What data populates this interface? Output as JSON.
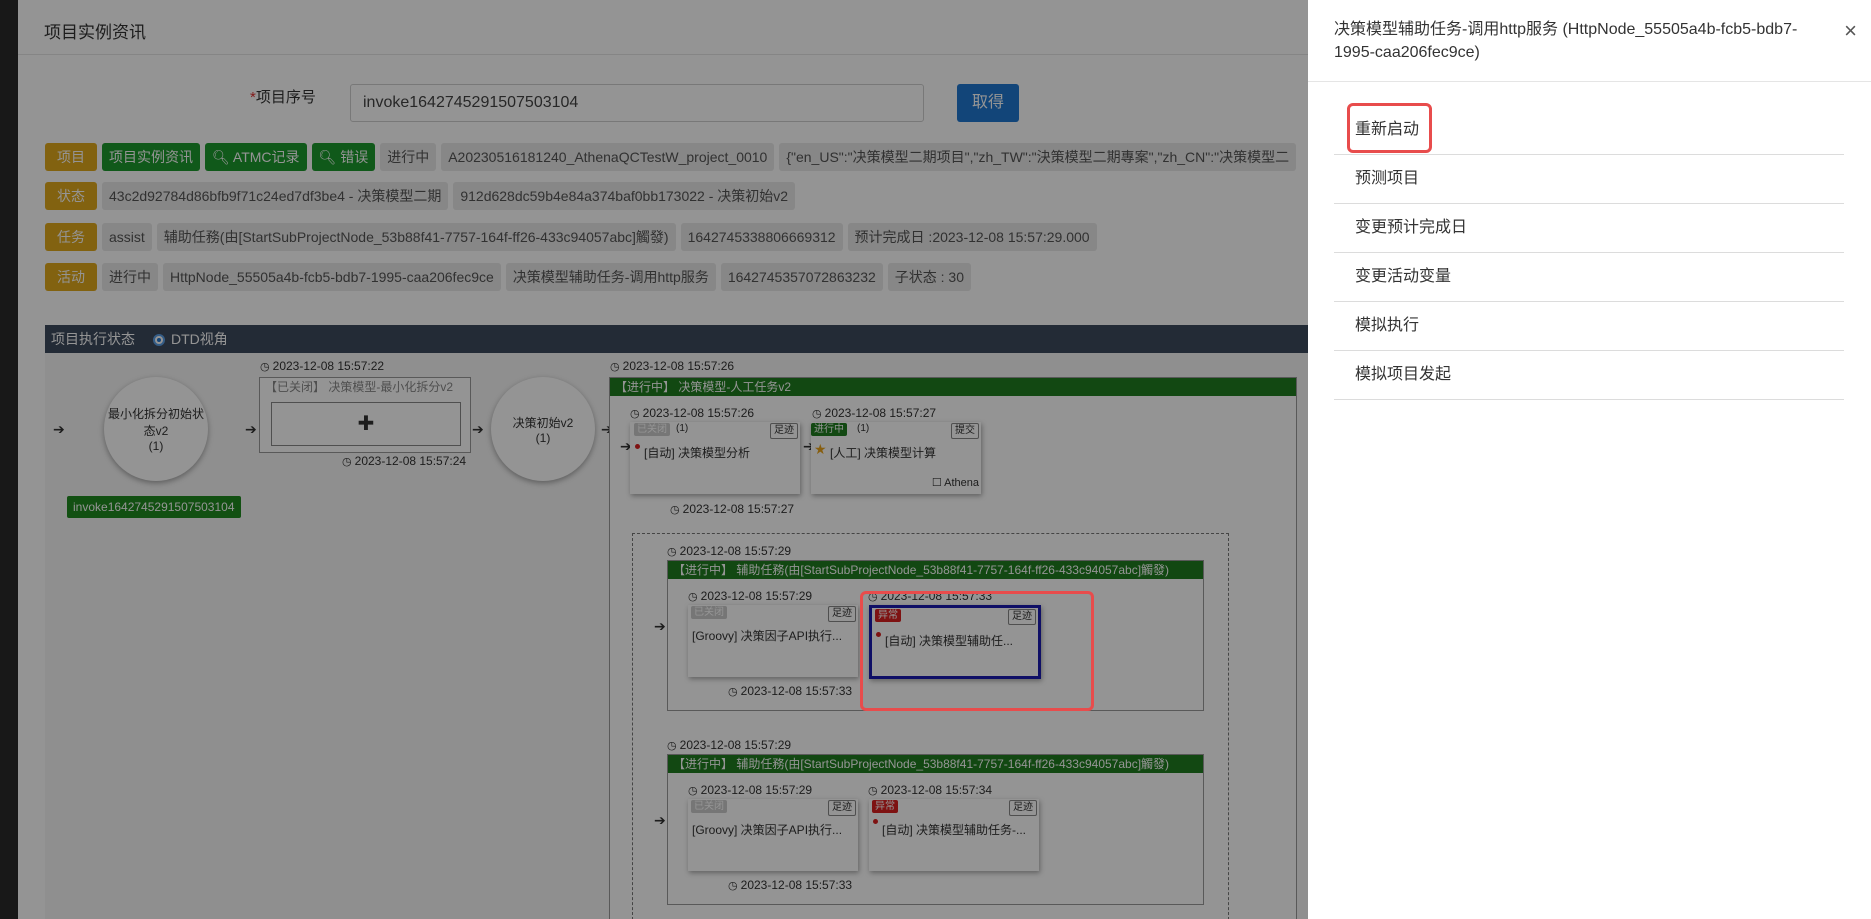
{
  "modal": {
    "title": "项目实例资讯",
    "field_required_mark": "*",
    "field_label": "项目序号",
    "field_value": "invoke1642745291507503104",
    "get_button": "取得"
  },
  "rows": {
    "project": {
      "label": "项目",
      "btn_info": "项目实例资讯",
      "btn_atmc": "ATMC记录",
      "btn_error": "错误",
      "status": "进行中",
      "code": "A20230516181240_AthenaQCTestW_project_0010",
      "json": "{\"en_US\":\"决策模型二期项目\",\"zh_TW\":\"決策模型二期專案\",\"zh_CN\":\"决策模型二"
    },
    "state": {
      "label": "状态",
      "v1": "43c2d92784d86bfb9f71c24ed7df3be4 - 决策模型二期",
      "v2": "912d628dc59b4e84a374baf0bb173022 - 决策初始v2"
    },
    "task": {
      "label": "任务",
      "type": "assist",
      "desc": "辅助任務(由[StartSubProjectNode_53b88f41-7757-164f-ff26-433c94057abc]觸發)",
      "id": "1642745338806669312",
      "due": "预计完成日 :2023-12-08 15:57:29.000"
    },
    "activity": {
      "label": "活动",
      "status": "进行中",
      "node": "HttpNode_55505a4b-fcb5-bdb7-1995-caa206fec9ce",
      "name": "决策模型辅助任务-调用http服务",
      "id": "1642745357072863232",
      "sub": "子状态 : 30"
    }
  },
  "exec": {
    "title": "项目执行状态",
    "radio": "DTD视角"
  },
  "diagram": {
    "c1": {
      "line1": "最小化拆分初始状",
      "line2": "态v2",
      "count": "(1)"
    },
    "c1_badge": "invoke1642745291507503104",
    "box1": {
      "ts_top": "2023-12-08 15:57:22",
      "head": "【已关闭】 决策模型-最小化拆分v2",
      "plus": "✚",
      "ts_bottom": "2023-12-08 15:57:24"
    },
    "c2": {
      "line1": "决策初始v2",
      "count": "(1)"
    },
    "main": {
      "ts_top": "2023-12-08 15:57:26",
      "head": "【进行中】 决策模型-人工任务v2"
    },
    "n1": {
      "ts": "2023-12-08 15:57:26",
      "tag": "已关闭",
      "count": "(1)",
      "btn": "足迹",
      "text": "[自动] 决策模型分析",
      "ts_bottom": "2023-12-08 15:57:27"
    },
    "n2": {
      "ts": "2023-12-08 15:57:27",
      "tag": "进行中",
      "count": "(1)",
      "btn": "提交",
      "star": "★",
      "text": "[人工] 决策模型计算",
      "owner": "☐ Athena"
    },
    "sub1": {
      "ts": "2023-12-08 15:57:29",
      "head": "【进行中】 辅助任務(由[StartSubProjectNode_53b88f41-7757-164f-ff26-433c94057abc]觸發)",
      "a": {
        "ts": "2023-12-08 15:57:29",
        "tag": "已关闭",
        "btn": "足迹",
        "text": "[Groovy] 决策因子API执行...",
        "ts_bottom": "2023-12-08 15:57:33"
      },
      "b": {
        "ts": "2023-12-08 15:57:33",
        "tag": "异常",
        "btn": "足迹",
        "text": "[自动] 决策模型辅助任..."
      }
    },
    "sub2": {
      "ts": "2023-12-08 15:57:29",
      "head": "【进行中】 辅助任務(由[StartSubProjectNode_53b88f41-7757-164f-ff26-433c94057abc]觸發)",
      "a": {
        "ts": "2023-12-08 15:57:29",
        "tag": "已关闭",
        "btn": "足迹",
        "text": "[Groovy] 决策因子API执行...",
        "ts_bottom": "2023-12-08 15:57:33"
      },
      "b": {
        "ts": "2023-12-08 15:57:34",
        "tag": "异常",
        "btn": "足迹",
        "text": "[自动] 决策模型辅助任务-..."
      }
    }
  },
  "panel": {
    "title": "决策模型辅助任务-调用http服务 (HttpNode_55505a4b-fcb5-bdb7-1995-caa206fec9ce)",
    "close": "×",
    "items": [
      "重新启动",
      "预测项目",
      "变更预计完成日",
      "变更活动变量",
      "模拟执行",
      "模拟项目发起"
    ]
  }
}
